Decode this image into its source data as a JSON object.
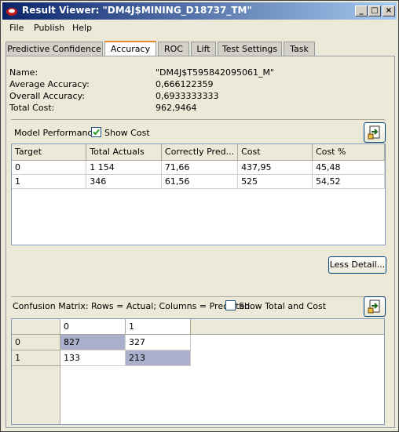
{
  "window": {
    "title": "Result Viewer: \"DM4J$MINING_D18737_TM\"",
    "buttons": {
      "minimize": "_",
      "maximize": "□",
      "close": "×"
    }
  },
  "menu": [
    "File",
    "Publish",
    "Help"
  ],
  "tabs": [
    "Predictive Confidence",
    "Accuracy",
    "ROC",
    "Lift",
    "Test Settings",
    "Task"
  ],
  "active_tab": "Accuracy",
  "summary": [
    {
      "label": "Name:",
      "value": "\"DM4J$T595842095061_M\""
    },
    {
      "label": "Average Accuracy:",
      "value": "0,666122359"
    },
    {
      "label": "Overall Accuracy:",
      "value": "0,6933333333"
    },
    {
      "label": "Total Cost:",
      "value": "962,9464"
    }
  ],
  "model_performance": {
    "label": "Model Performance",
    "show_cost_label": "Show Cost",
    "show_cost_checked": true,
    "columns": [
      "Target",
      "Total Actuals",
      "Correctly Pred...",
      "Cost",
      "Cost %"
    ],
    "rows": [
      [
        "0",
        "1 154",
        "71,66",
        "437,95",
        "45,48"
      ],
      [
        "1",
        "346",
        "61,56",
        "525",
        "54,52"
      ]
    ]
  },
  "less_detail_label": "Less Detail...",
  "confusion": {
    "label": "Confusion Matrix:  Rows = Actual; Columns = Predicted",
    "show_total_label": "Show Total and Cost",
    "show_total_checked": false,
    "columns": [
      "0",
      "1"
    ],
    "rows": [
      {
        "label": "0",
        "cells": [
          "827",
          "327"
        ]
      },
      {
        "label": "1",
        "cells": [
          "133",
          "213"
        ]
      }
    ]
  }
}
